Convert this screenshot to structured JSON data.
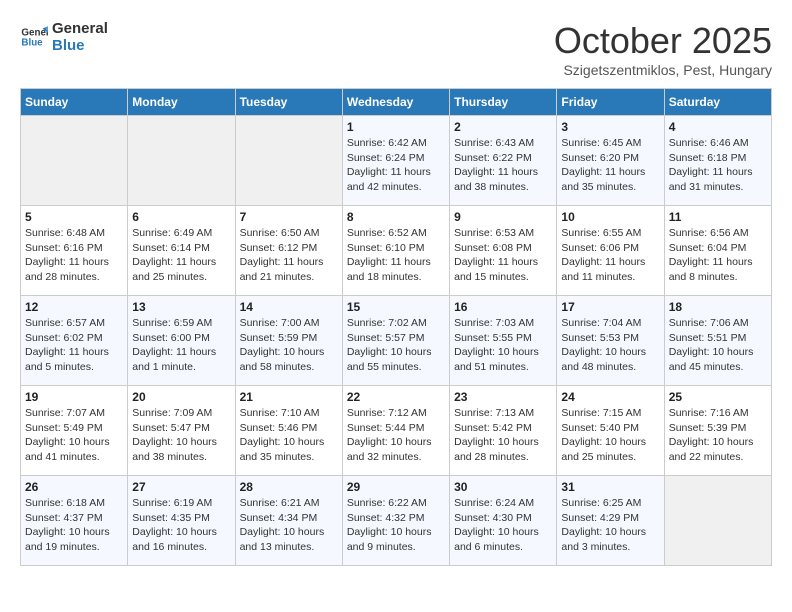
{
  "logo": {
    "line1": "General",
    "line2": "Blue"
  },
  "title": "October 2025",
  "subtitle": "Szigetszentmiklos, Pest, Hungary",
  "headers": [
    "Sunday",
    "Monday",
    "Tuesday",
    "Wednesday",
    "Thursday",
    "Friday",
    "Saturday"
  ],
  "weeks": [
    [
      {
        "day": "",
        "info": ""
      },
      {
        "day": "",
        "info": ""
      },
      {
        "day": "",
        "info": ""
      },
      {
        "day": "1",
        "info": "Sunrise: 6:42 AM\nSunset: 6:24 PM\nDaylight: 11 hours\nand 42 minutes."
      },
      {
        "day": "2",
        "info": "Sunrise: 6:43 AM\nSunset: 6:22 PM\nDaylight: 11 hours\nand 38 minutes."
      },
      {
        "day": "3",
        "info": "Sunrise: 6:45 AM\nSunset: 6:20 PM\nDaylight: 11 hours\nand 35 minutes."
      },
      {
        "day": "4",
        "info": "Sunrise: 6:46 AM\nSunset: 6:18 PM\nDaylight: 11 hours\nand 31 minutes."
      }
    ],
    [
      {
        "day": "5",
        "info": "Sunrise: 6:48 AM\nSunset: 6:16 PM\nDaylight: 11 hours\nand 28 minutes."
      },
      {
        "day": "6",
        "info": "Sunrise: 6:49 AM\nSunset: 6:14 PM\nDaylight: 11 hours\nand 25 minutes."
      },
      {
        "day": "7",
        "info": "Sunrise: 6:50 AM\nSunset: 6:12 PM\nDaylight: 11 hours\nand 21 minutes."
      },
      {
        "day": "8",
        "info": "Sunrise: 6:52 AM\nSunset: 6:10 PM\nDaylight: 11 hours\nand 18 minutes."
      },
      {
        "day": "9",
        "info": "Sunrise: 6:53 AM\nSunset: 6:08 PM\nDaylight: 11 hours\nand 15 minutes."
      },
      {
        "day": "10",
        "info": "Sunrise: 6:55 AM\nSunset: 6:06 PM\nDaylight: 11 hours\nand 11 minutes."
      },
      {
        "day": "11",
        "info": "Sunrise: 6:56 AM\nSunset: 6:04 PM\nDaylight: 11 hours\nand 8 minutes."
      }
    ],
    [
      {
        "day": "12",
        "info": "Sunrise: 6:57 AM\nSunset: 6:02 PM\nDaylight: 11 hours\nand 5 minutes."
      },
      {
        "day": "13",
        "info": "Sunrise: 6:59 AM\nSunset: 6:00 PM\nDaylight: 11 hours\nand 1 minute."
      },
      {
        "day": "14",
        "info": "Sunrise: 7:00 AM\nSunset: 5:59 PM\nDaylight: 10 hours\nand 58 minutes."
      },
      {
        "day": "15",
        "info": "Sunrise: 7:02 AM\nSunset: 5:57 PM\nDaylight: 10 hours\nand 55 minutes."
      },
      {
        "day": "16",
        "info": "Sunrise: 7:03 AM\nSunset: 5:55 PM\nDaylight: 10 hours\nand 51 minutes."
      },
      {
        "day": "17",
        "info": "Sunrise: 7:04 AM\nSunset: 5:53 PM\nDaylight: 10 hours\nand 48 minutes."
      },
      {
        "day": "18",
        "info": "Sunrise: 7:06 AM\nSunset: 5:51 PM\nDaylight: 10 hours\nand 45 minutes."
      }
    ],
    [
      {
        "day": "19",
        "info": "Sunrise: 7:07 AM\nSunset: 5:49 PM\nDaylight: 10 hours\nand 41 minutes."
      },
      {
        "day": "20",
        "info": "Sunrise: 7:09 AM\nSunset: 5:47 PM\nDaylight: 10 hours\nand 38 minutes."
      },
      {
        "day": "21",
        "info": "Sunrise: 7:10 AM\nSunset: 5:46 PM\nDaylight: 10 hours\nand 35 minutes."
      },
      {
        "day": "22",
        "info": "Sunrise: 7:12 AM\nSunset: 5:44 PM\nDaylight: 10 hours\nand 32 minutes."
      },
      {
        "day": "23",
        "info": "Sunrise: 7:13 AM\nSunset: 5:42 PM\nDaylight: 10 hours\nand 28 minutes."
      },
      {
        "day": "24",
        "info": "Sunrise: 7:15 AM\nSunset: 5:40 PM\nDaylight: 10 hours\nand 25 minutes."
      },
      {
        "day": "25",
        "info": "Sunrise: 7:16 AM\nSunset: 5:39 PM\nDaylight: 10 hours\nand 22 minutes."
      }
    ],
    [
      {
        "day": "26",
        "info": "Sunrise: 6:18 AM\nSunset: 4:37 PM\nDaylight: 10 hours\nand 19 minutes."
      },
      {
        "day": "27",
        "info": "Sunrise: 6:19 AM\nSunset: 4:35 PM\nDaylight: 10 hours\nand 16 minutes."
      },
      {
        "day": "28",
        "info": "Sunrise: 6:21 AM\nSunset: 4:34 PM\nDaylight: 10 hours\nand 13 minutes."
      },
      {
        "day": "29",
        "info": "Sunrise: 6:22 AM\nSunset: 4:32 PM\nDaylight: 10 hours\nand 9 minutes."
      },
      {
        "day": "30",
        "info": "Sunrise: 6:24 AM\nSunset: 4:30 PM\nDaylight: 10 hours\nand 6 minutes."
      },
      {
        "day": "31",
        "info": "Sunrise: 6:25 AM\nSunset: 4:29 PM\nDaylight: 10 hours\nand 3 minutes."
      },
      {
        "day": "",
        "info": ""
      }
    ]
  ]
}
